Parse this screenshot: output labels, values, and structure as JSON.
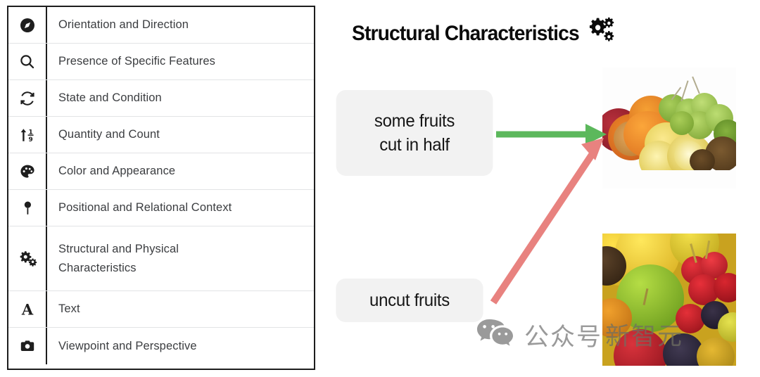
{
  "table": {
    "rows": [
      {
        "icon": "compass-icon",
        "label": "Orientation and Direction"
      },
      {
        "icon": "search-icon",
        "label": "Presence of Specific Features"
      },
      {
        "icon": "refresh-cycle-icon",
        "label": "State and Condition"
      },
      {
        "icon": "sort-numeric-icon",
        "label": "Quantity and Count"
      },
      {
        "icon": "palette-icon",
        "label": "Color and Appearance"
      },
      {
        "icon": "map-pin-icon",
        "label": "Positional and Relational Context"
      },
      {
        "icon": "gears-icon",
        "label": "Structural and Physical Characteristics"
      },
      {
        "icon": "letter-a-icon",
        "label": "Text"
      },
      {
        "icon": "camera-icon",
        "label": "Viewpoint and Perspective"
      }
    ]
  },
  "diagram": {
    "title": "Structural Characteristics",
    "title_icon": "gears-icon",
    "callouts": {
      "cut_line1": "some fruits",
      "cut_line2": "cut in half",
      "uncut": "uncut fruits"
    },
    "arrows": [
      {
        "name": "green-arrow",
        "from": "some fruits cut in half",
        "to": "cut-fruits-photo",
        "color": "#5cb85c"
      },
      {
        "name": "red-arrow",
        "from": "uncut fruits",
        "to": "cut-fruits-photo",
        "color": "#e8827f"
      }
    ],
    "photos": [
      {
        "name": "cut-fruits-photo",
        "alt": "oranges lemons grapes kiwi cut in half on white background"
      },
      {
        "name": "uncut-fruits-photo",
        "alt": "close-up of whole uncut fruits: apple, lemon, cherries, berries"
      }
    ]
  },
  "watermark": {
    "icon": "wechat-icon",
    "text_1": "公众号",
    "text_2": "新智元"
  },
  "colors": {
    "green_arrow": "#5cb85c",
    "red_arrow": "#e8827f",
    "callout_bg": "#f2f2f2",
    "table_border": "#1d1d1d",
    "row_divider": "#e2e3e5",
    "label_text": "#3b3d40"
  }
}
